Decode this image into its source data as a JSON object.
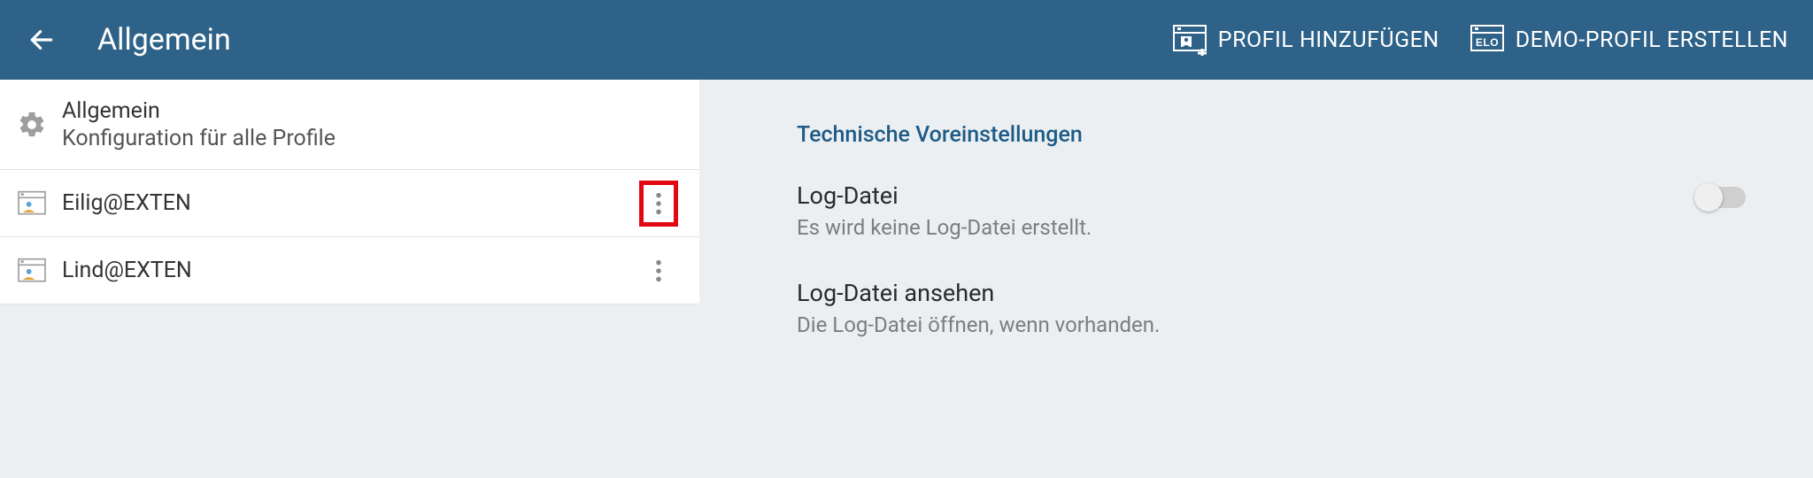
{
  "appbar": {
    "title": "Allgemein",
    "actions": {
      "add_profile": "PROFIL HINZUFÜGEN",
      "create_demo": "DEMO-PROFIL ERSTELLEN",
      "elo_label": "ELO"
    }
  },
  "sidebar": {
    "general": {
      "title": "Allgemein",
      "subtitle": "Konfiguration für alle Profile"
    },
    "profiles": [
      {
        "name": "Eilig@EXTEN",
        "highlighted": true
      },
      {
        "name": "Lind@EXTEN",
        "highlighted": false
      }
    ]
  },
  "settings": {
    "section_header": "Technische Voreinstellungen",
    "log_file": {
      "title": "Log-Datei",
      "subtitle": "Es wird keine Log-Datei erstellt.",
      "enabled": false
    },
    "view_log": {
      "title": "Log-Datei ansehen",
      "subtitle": "Die Log-Datei öffnen, wenn vorhanden."
    }
  }
}
